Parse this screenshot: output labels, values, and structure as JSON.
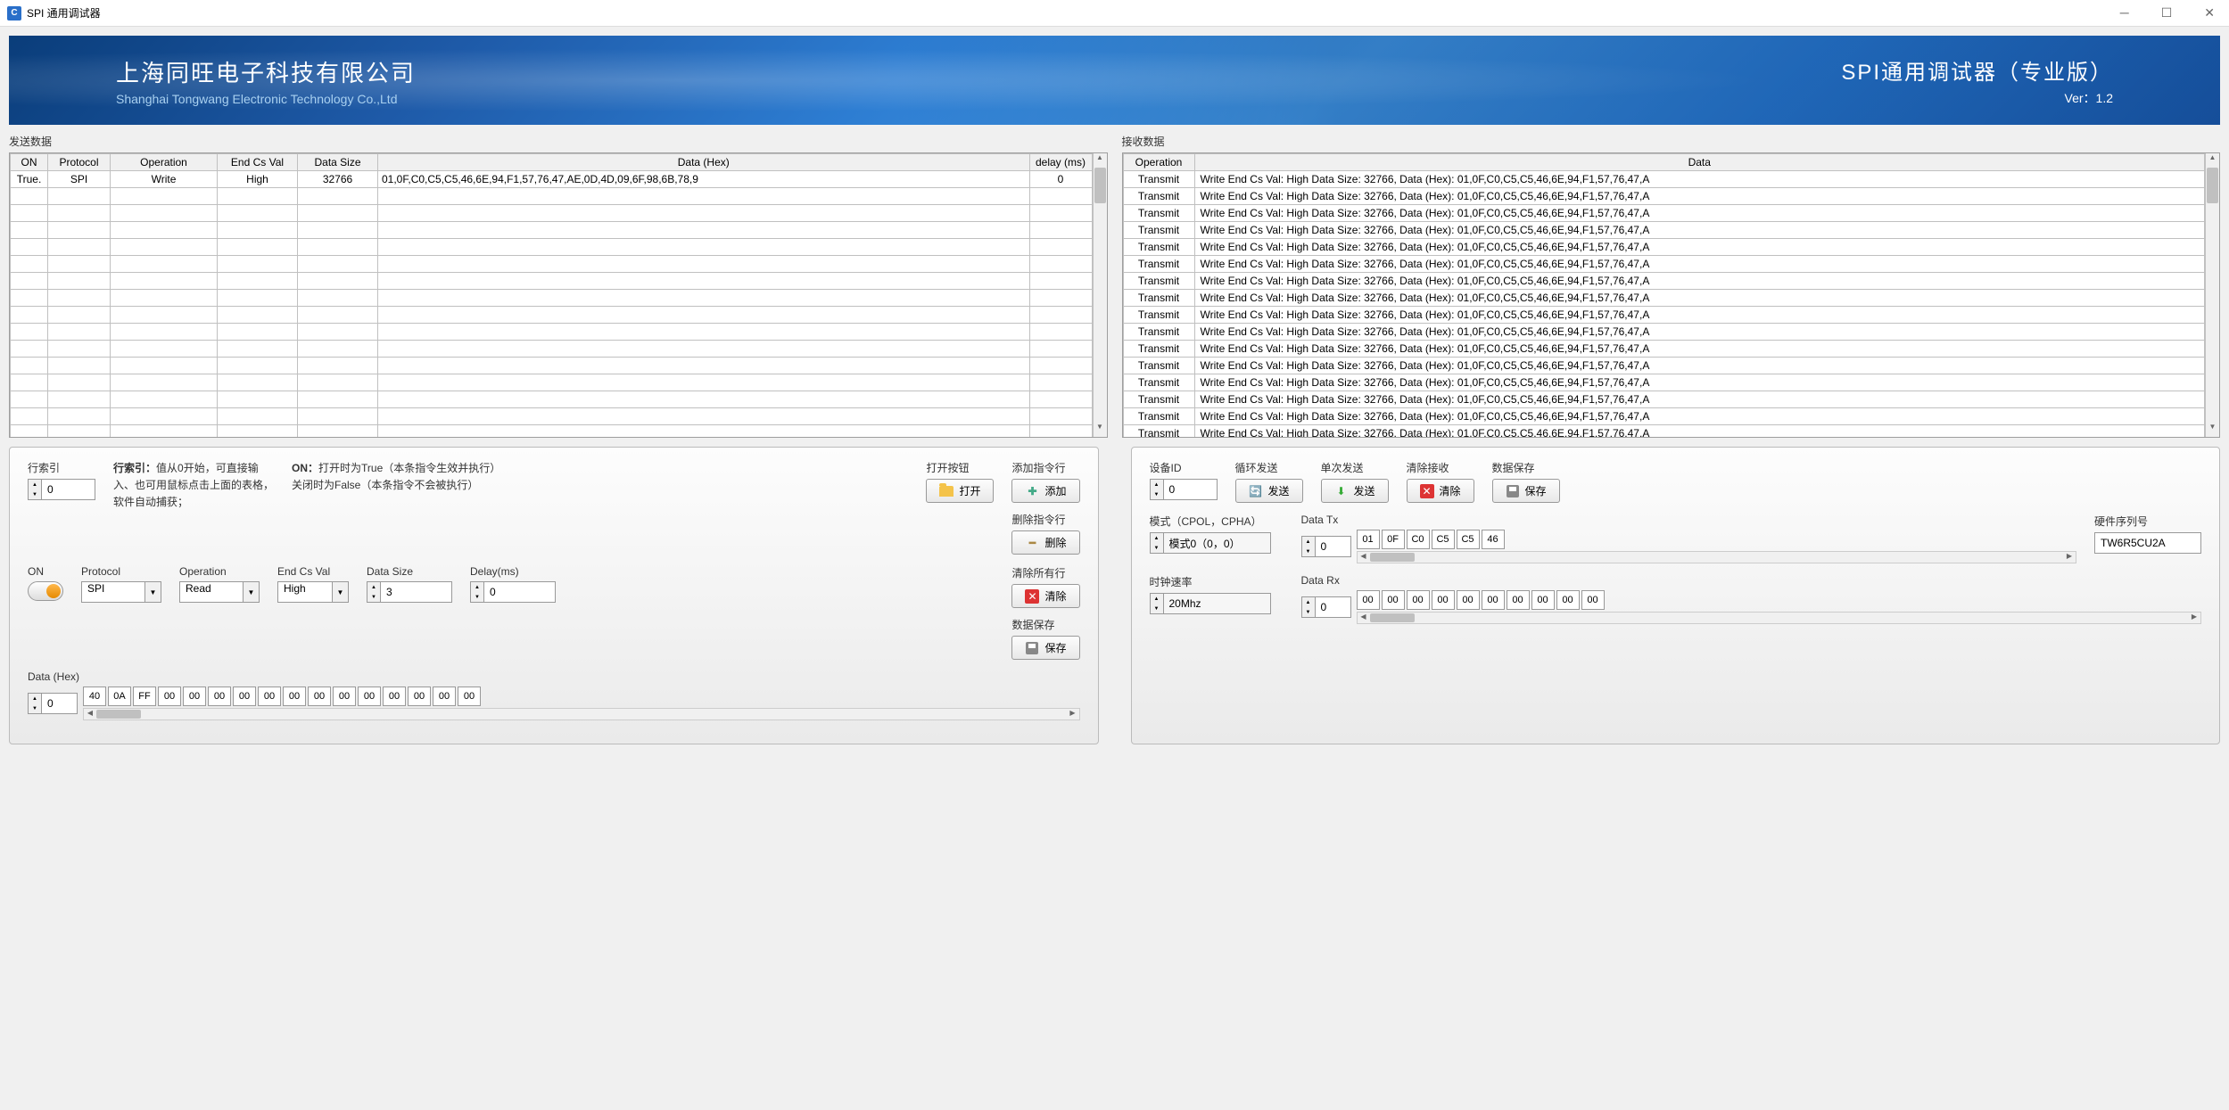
{
  "window": {
    "title": "SPI 通用调试器"
  },
  "banner": {
    "company_cn": "上海同旺电子科技有限公司",
    "company_en": "Shanghai Tongwang Electronic Technology Co.,Ltd",
    "product": "SPI通用调试器（专业版）",
    "version": "Ver：1.2"
  },
  "send": {
    "title": "发送数据",
    "headers": [
      "ON",
      "Protocol",
      "Operation",
      "End Cs Val",
      "Data Size",
      "Data (Hex)",
      "delay (ms)"
    ],
    "rows": [
      {
        "on": "True.",
        "protocol": "SPI",
        "operation": "Write",
        "endcs": "High",
        "size": "32766",
        "data": "01,0F,C0,C5,C5,46,6E,94,F1,57,76,47,AE,0D,4D,09,6F,98,6B,78,9",
        "delay": "0"
      }
    ],
    "empty_rows": 15
  },
  "recv": {
    "title": "接收数据",
    "headers": [
      "Operation",
      "Data"
    ],
    "row_template": {
      "op": "Transmit",
      "data": "Write    End Cs Val: High     Data Size: 32766,      Data (Hex): 01,0F,C0,C5,C5,46,6E,94,F1,57,76,47,A"
    },
    "row_count": 16
  },
  "panel_left": {
    "row_index_label": "行索引",
    "row_index_value": "0",
    "help_rowindex": "值从0开始，可直接输入、也可用鼠标点击上面的表格，软件自动捕获；",
    "help_rowindex_b": "行索引：",
    "help_on_b": "ON：",
    "help_on": "打开时为True（本条指令生效并执行）\n关闭时为False（本条指令不会被执行）",
    "on_label": "ON",
    "protocol_label": "Protocol",
    "protocol_value": "SPI",
    "operation_label": "Operation",
    "operation_value": "Read",
    "endcs_label": "End Cs Val",
    "endcs_value": "High",
    "datasize_label": "Data Size",
    "datasize_value": "3",
    "delay_label": "Delay(ms)",
    "delay_value": "0",
    "datahex_label": "Data (Hex)",
    "datahex_index": "0",
    "datahex": [
      "40",
      "0A",
      "FF",
      "00",
      "00",
      "00",
      "00",
      "00",
      "00",
      "00",
      "00",
      "00",
      "00",
      "00",
      "00",
      "00"
    ],
    "open_group": "打开按钮",
    "open_btn": "打开",
    "add_group": "添加指令行",
    "add_btn": "添加",
    "del_group": "删除指令行",
    "del_btn": "删除",
    "clear_group": "清除所有行",
    "clear_btn": "清除",
    "save_group": "数据保存",
    "save_btn": "保存"
  },
  "panel_right": {
    "device_label": "设备ID",
    "device_value": "0",
    "loop_group": "循环发送",
    "loop_btn": "发送",
    "once_group": "单次发送",
    "once_btn": "发送",
    "clear_group": "清除接收",
    "clear_btn": "清除",
    "save_group": "数据保存",
    "save_btn": "保存",
    "mode_label": "模式（CPOL，CPHA）",
    "mode_value": "模式0（0，0）",
    "datatx_label": "Data Tx",
    "datatx_index": "0",
    "datatx": [
      "01",
      "0F",
      "C0",
      "C5",
      "C5",
      "46"
    ],
    "hwsn_label": "硬件序列号",
    "hwsn_value": "TW6R5CU2A",
    "clock_label": "时钟速率",
    "clock_value": "20Mhz",
    "datarx_label": "Data Rx",
    "datarx_index": "0",
    "datarx": [
      "00",
      "00",
      "00",
      "00",
      "00",
      "00",
      "00",
      "00",
      "00",
      "00"
    ]
  }
}
